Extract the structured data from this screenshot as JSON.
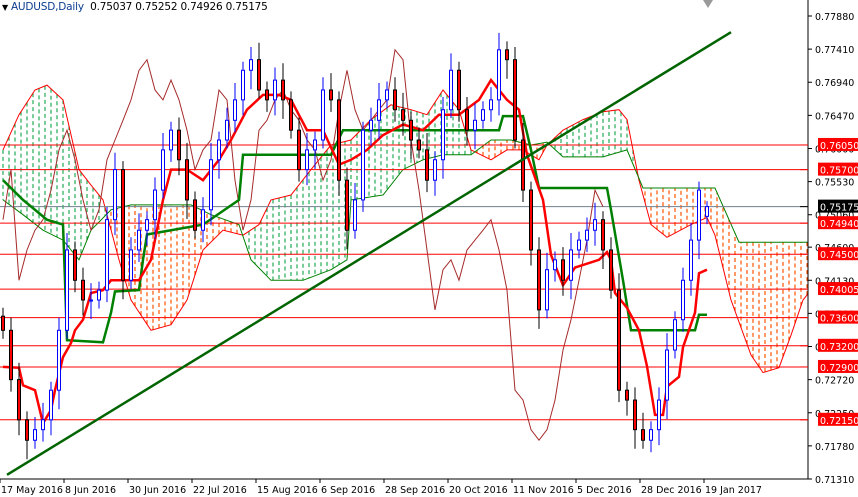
{
  "header": {
    "menu_icon": "triangle-down-icon",
    "symbol": "AUDUSD,Daily",
    "ohlc_text": "0.75037 0.75252 0.74926 0.75175"
  },
  "chart_data": {
    "type": "candlestick",
    "title": "AUDUSD,Daily",
    "ylim": [
      0.7131,
      0.7788
    ],
    "x_unit": "bar index (daily bars)",
    "xlim": [
      0,
      202
    ],
    "grid": false,
    "colors": {
      "bull": "#0000ff",
      "bear": "#ff0000",
      "tenkan": "#ff0000",
      "kijun": "#008000",
      "span_a": "#ff0000",
      "span_b": "#008000",
      "cloud_bull": "#22aa55",
      "cloud_bear": "#ff5500",
      "chikou": "#a52a2a",
      "level": "#ff0000",
      "current": "#708090",
      "trendline": "#006400"
    },
    "y_ticks": [
      "0.77880",
      "0.77410",
      "0.76940",
      "0.76470",
      "0.76000",
      "0.75530",
      "0.75060",
      "0.74600",
      "0.74130",
      "0.73660",
      "0.73190",
      "0.72720",
      "0.72250",
      "0.71780",
      "0.71310"
    ],
    "x_ticks": [
      {
        "label": "17 May 2016",
        "bar": 0
      },
      {
        "label": "8 Jun 2016",
        "bar": 16
      },
      {
        "label": "30 Jun 2016",
        "bar": 32
      },
      {
        "label": "22 Jul 2016",
        "bar": 48
      },
      {
        "label": "15 Aug 2016",
        "bar": 64
      },
      {
        "label": "6 Sep 2016",
        "bar": 80
      },
      {
        "label": "28 Sep 2016",
        "bar": 96
      },
      {
        "label": "20 Oct 2016",
        "bar": 112
      },
      {
        "label": "11 Nov 2016",
        "bar": 128
      },
      {
        "label": "5 Dec 2016",
        "bar": 144
      },
      {
        "label": "28 Dec 2016",
        "bar": 160
      },
      {
        "label": "19 Jan 2017",
        "bar": 176
      }
    ],
    "candle_step_bars": 2,
    "closes": [
      0.7342,
      0.7272,
      0.7215,
      0.7186,
      0.7201,
      0.7215,
      0.7257,
      0.7342,
      0.7456,
      0.7413,
      0.7385,
      0.7385,
      0.7399,
      0.7499,
      0.757,
      0.7413,
      0.7456,
      0.7484,
      0.7499,
      0.7541,
      0.7598,
      0.7626,
      0.7584,
      0.7527,
      0.7484,
      0.7513,
      0.7584,
      0.7612,
      0.764,
      0.7669,
      0.7711,
      0.7726,
      0.7683,
      0.7669,
      0.7697,
      0.7669,
      0.7626,
      0.757,
      0.7598,
      0.7612,
      0.7683,
      0.7669,
      0.7555,
      0.7484,
      0.7527,
      0.7626,
      0.764,
      0.7669,
      0.7683,
      0.7655,
      0.764,
      0.7612,
      0.7598,
      0.7555,
      0.7584,
      0.7655,
      0.7711,
      0.7655,
      0.7626,
      0.764,
      0.7655,
      0.7669,
      0.774,
      0.7726,
      0.7612,
      0.7541,
      0.7456,
      0.7371,
      0.7428,
      0.7442,
      0.7413,
      0.7456,
      0.747,
      0.7484,
      0.7499,
      0.7456,
      0.7399,
      0.7257,
      0.7243,
      0.7201,
      0.7186,
      0.7201,
      0.7243,
      0.7314,
      0.7357,
      0.7413,
      0.747,
      0.7541,
      0.75175
    ],
    "last_candle": {
      "open": 0.75037,
      "high": 0.75252,
      "low": 0.74926,
      "close": 0.75175
    },
    "tenkan": [
      [
        0,
        0.729
      ],
      [
        4,
        0.7289
      ],
      [
        5,
        0.7264
      ],
      [
        8,
        0.7257
      ],
      [
        10,
        0.721
      ],
      [
        12,
        0.7229
      ],
      [
        13,
        0.7257
      ],
      [
        15,
        0.7304
      ],
      [
        17,
        0.7324
      ],
      [
        18,
        0.7342
      ],
      [
        20,
        0.7357
      ],
      [
        22,
        0.7395
      ],
      [
        25,
        0.7399
      ],
      [
        27,
        0.7413
      ],
      [
        34,
        0.7413
      ],
      [
        37,
        0.7442
      ],
      [
        40,
        0.7527
      ],
      [
        42,
        0.757
      ],
      [
        46,
        0.757
      ],
      [
        50,
        0.7555
      ],
      [
        54,
        0.7584
      ],
      [
        57,
        0.7612
      ],
      [
        61,
        0.7655
      ],
      [
        65,
        0.7676
      ],
      [
        69,
        0.7676
      ],
      [
        72,
        0.7669
      ],
      [
        76,
        0.7626
      ],
      [
        80,
        0.7626
      ],
      [
        84,
        0.7577
      ],
      [
        87,
        0.7584
      ],
      [
        91,
        0.7598
      ],
      [
        95,
        0.7619
      ],
      [
        100,
        0.7634
      ],
      [
        105,
        0.7626
      ],
      [
        109,
        0.7648
      ],
      [
        114,
        0.7648
      ],
      [
        119,
        0.7669
      ],
      [
        122,
        0.7697
      ],
      [
        126,
        0.7669
      ],
      [
        129,
        0.7655
      ],
      [
        131,
        0.7591
      ],
      [
        135,
        0.7527
      ],
      [
        137,
        0.7449
      ],
      [
        140,
        0.7406
      ],
      [
        143,
        0.7431
      ],
      [
        149,
        0.7442
      ],
      [
        151,
        0.7453
      ],
      [
        152,
        0.7442
      ],
      [
        153,
        0.7395
      ],
      [
        156,
        0.7374
      ],
      [
        159,
        0.7342
      ],
      [
        161,
        0.7291
      ],
      [
        163,
        0.7222
      ],
      [
        165,
        0.7222
      ],
      [
        166,
        0.7262
      ],
      [
        169,
        0.7276
      ],
      [
        170,
        0.7318
      ],
      [
        173,
        0.7367
      ],
      [
        174,
        0.7423
      ],
      [
        176,
        0.7428
      ]
    ],
    "kijun": [
      [
        0,
        0.7555
      ],
      [
        5,
        0.7527
      ],
      [
        11,
        0.7499
      ],
      [
        15,
        0.7492
      ],
      [
        15.5,
        0.7413
      ],
      [
        16,
        0.7328
      ],
      [
        25,
        0.7325
      ],
      [
        27,
        0.7367
      ],
      [
        28,
        0.7397
      ],
      [
        34,
        0.7399
      ],
      [
        35,
        0.7442
      ],
      [
        36,
        0.7478
      ],
      [
        50,
        0.7492
      ],
      [
        59,
        0.7527
      ],
      [
        60,
        0.7591
      ],
      [
        82,
        0.7591
      ],
      [
        85,
        0.7626
      ],
      [
        124,
        0.7626
      ],
      [
        125,
        0.7646
      ],
      [
        130,
        0.7646
      ],
      [
        132,
        0.7598
      ],
      [
        134,
        0.7544
      ],
      [
        151,
        0.7544
      ],
      [
        152,
        0.7513
      ],
      [
        155,
        0.7413
      ],
      [
        157,
        0.7342
      ],
      [
        173,
        0.7342
      ],
      [
        174,
        0.7364
      ],
      [
        176,
        0.7364
      ]
    ],
    "span_a": [
      [
        0,
        0.7598
      ],
      [
        4,
        0.7648
      ],
      [
        8,
        0.7683
      ],
      [
        11,
        0.769
      ],
      [
        15,
        0.7669
      ],
      [
        19,
        0.757
      ],
      [
        22,
        0.7548
      ],
      [
        25,
        0.7527
      ],
      [
        29,
        0.7442
      ],
      [
        32,
        0.7385
      ],
      [
        37,
        0.7342
      ],
      [
        42,
        0.735
      ],
      [
        46,
        0.7385
      ],
      [
        50,
        0.7456
      ],
      [
        55,
        0.7484
      ],
      [
        60,
        0.7477
      ],
      [
        64,
        0.7492
      ],
      [
        67,
        0.7527
      ],
      [
        72,
        0.7534
      ],
      [
        77,
        0.757
      ],
      [
        82,
        0.7605
      ],
      [
        87,
        0.7612
      ],
      [
        92,
        0.7641
      ],
      [
        97,
        0.7662
      ],
      [
        102,
        0.7655
      ],
      [
        106,
        0.7648
      ],
      [
        110,
        0.7683
      ],
      [
        114,
        0.7655
      ],
      [
        117,
        0.7598
      ],
      [
        122,
        0.7584
      ],
      [
        126,
        0.7598
      ],
      [
        130,
        0.7598
      ],
      [
        134,
        0.7584
      ],
      [
        136,
        0.7605
      ],
      [
        140,
        0.7626
      ],
      [
        145,
        0.7641
      ],
      [
        150,
        0.7652
      ],
      [
        154,
        0.7655
      ],
      [
        156,
        0.7641
      ],
      [
        159,
        0.7555
      ],
      [
        162,
        0.7492
      ],
      [
        166,
        0.7474
      ],
      [
        172,
        0.7492
      ],
      [
        176,
        0.7502
      ],
      [
        178,
        0.7477
      ],
      [
        182,
        0.7385
      ],
      [
        187,
        0.7307
      ],
      [
        190,
        0.7282
      ],
      [
        194,
        0.7289
      ],
      [
        197,
        0.7335
      ],
      [
        200,
        0.7385
      ],
      [
        202,
        0.7399
      ]
    ],
    "span_b": [
      [
        0,
        0.7527
      ],
      [
        5,
        0.7506
      ],
      [
        10,
        0.7484
      ],
      [
        15,
        0.747
      ],
      [
        19,
        0.7442
      ],
      [
        22,
        0.7484
      ],
      [
        27,
        0.7513
      ],
      [
        32,
        0.752
      ],
      [
        47,
        0.752
      ],
      [
        52,
        0.7506
      ],
      [
        59,
        0.7492
      ],
      [
        62,
        0.7442
      ],
      [
        67,
        0.7413
      ],
      [
        75,
        0.7413
      ],
      [
        82,
        0.7428
      ],
      [
        86,
        0.7442
      ],
      [
        87,
        0.7527
      ],
      [
        95,
        0.7534
      ],
      [
        100,
        0.757
      ],
      [
        105,
        0.7584
      ],
      [
        110,
        0.7591
      ],
      [
        117,
        0.7591
      ],
      [
        122,
        0.7612
      ],
      [
        127,
        0.7612
      ],
      [
        132,
        0.7605
      ],
      [
        136,
        0.7609
      ],
      [
        140,
        0.7588
      ],
      [
        150,
        0.7588
      ],
      [
        156,
        0.7598
      ],
      [
        160,
        0.7544
      ],
      [
        178,
        0.7544
      ],
      [
        184,
        0.7467
      ],
      [
        202,
        0.7467
      ]
    ],
    "trendline": [
      [
        1,
        0.7137
      ],
      [
        182,
        0.7765
      ]
    ],
    "levels": [
      {
        "label": "0.76050",
        "price": 0.7605
      },
      {
        "label": "0.75700",
        "price": 0.757
      },
      {
        "label": "0.74940",
        "price": 0.7494
      },
      {
        "label": "0.74500",
        "price": 0.745
      },
      {
        "label": "0.74005",
        "price": 0.74005
      },
      {
        "label": "0.73600",
        "price": 0.736
      },
      {
        "label": "0.73200",
        "price": 0.732
      },
      {
        "label": "0.72900",
        "price": 0.729
      },
      {
        "label": "0.72150",
        "price": 0.7215
      }
    ],
    "current_price": {
      "label": "0.75175",
      "price": 0.75175
    }
  }
}
